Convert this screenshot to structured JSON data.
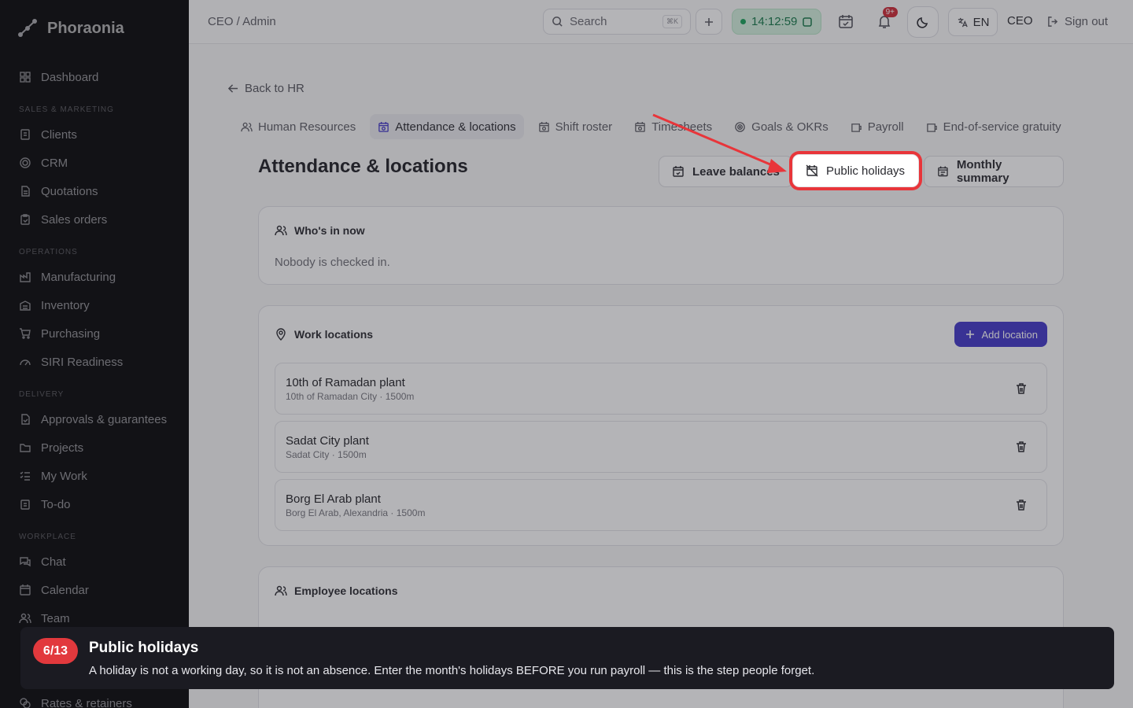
{
  "brand": {
    "name": "Phoraonia"
  },
  "sidebar": {
    "dashboard": "Dashboard",
    "sections": [
      {
        "title": "SALES & MARKETING",
        "items": [
          "Clients",
          "CRM",
          "Quotations",
          "Sales orders"
        ]
      },
      {
        "title": "OPERATIONS",
        "items": [
          "Manufacturing",
          "Inventory",
          "Purchasing",
          "SIRI Readiness"
        ]
      },
      {
        "title": "DELIVERY",
        "items": [
          "Approvals & guarantees",
          "Projects",
          "My Work",
          "To-do"
        ]
      },
      {
        "title": "WORKPLACE",
        "items": [
          "Chat",
          "Calendar",
          "Team"
        ]
      }
    ],
    "bottom_item": "Rates & retainers"
  },
  "topbar": {
    "breadcrumb": "CEO / Admin",
    "search_placeholder": "Search",
    "search_shortcut": "⌘K",
    "clock": "14:12:59",
    "notifications_badge": "9+",
    "language": "EN",
    "role": "CEO",
    "sign_out": "Sign out"
  },
  "main": {
    "back_label": "Back to HR",
    "tabs": [
      {
        "label": "Human Resources",
        "icon": "users-icon"
      },
      {
        "label": "Attendance & locations",
        "icon": "calendar-clock-icon"
      },
      {
        "label": "Shift roster",
        "icon": "calendar-clock-icon"
      },
      {
        "label": "Timesheets",
        "icon": "calendar-clock-icon"
      },
      {
        "label": "Goals & OKRs",
        "icon": "target-icon"
      },
      {
        "label": "Payroll",
        "icon": "wallet-icon"
      },
      {
        "label": "End-of-service gratuity",
        "icon": "wallet-icon"
      }
    ],
    "page_title": "Attendance & locations",
    "actions": {
      "leave_balances": "Leave balances",
      "public_holidays": "Public holidays",
      "monthly_summary": "Monthly summary"
    },
    "whos_in": {
      "title": "Who's in now",
      "empty": "Nobody is checked in."
    },
    "work_locations": {
      "title": "Work locations",
      "add_label": "Add location",
      "items": [
        {
          "name": "10th of Ramadan plant",
          "detail": "10th of Ramadan City · 1500m"
        },
        {
          "name": "Sadat City plant",
          "detail": "Sadat City · 1500m"
        },
        {
          "name": "Borg El Arab plant",
          "detail": "Borg El Arab, Alexandria · 1500m"
        }
      ]
    },
    "employee_locations": {
      "title": "Employee locations"
    }
  },
  "tour": {
    "step": "6/13",
    "title": "Public holidays",
    "body": "A holiday is not a working day, so it is not an absence. Enter the month's holidays BEFORE you run payroll — this is the step people forget."
  },
  "colors": {
    "accent": "#4338ca",
    "highlight": "#e8353a",
    "clock_green": "#16794a"
  }
}
